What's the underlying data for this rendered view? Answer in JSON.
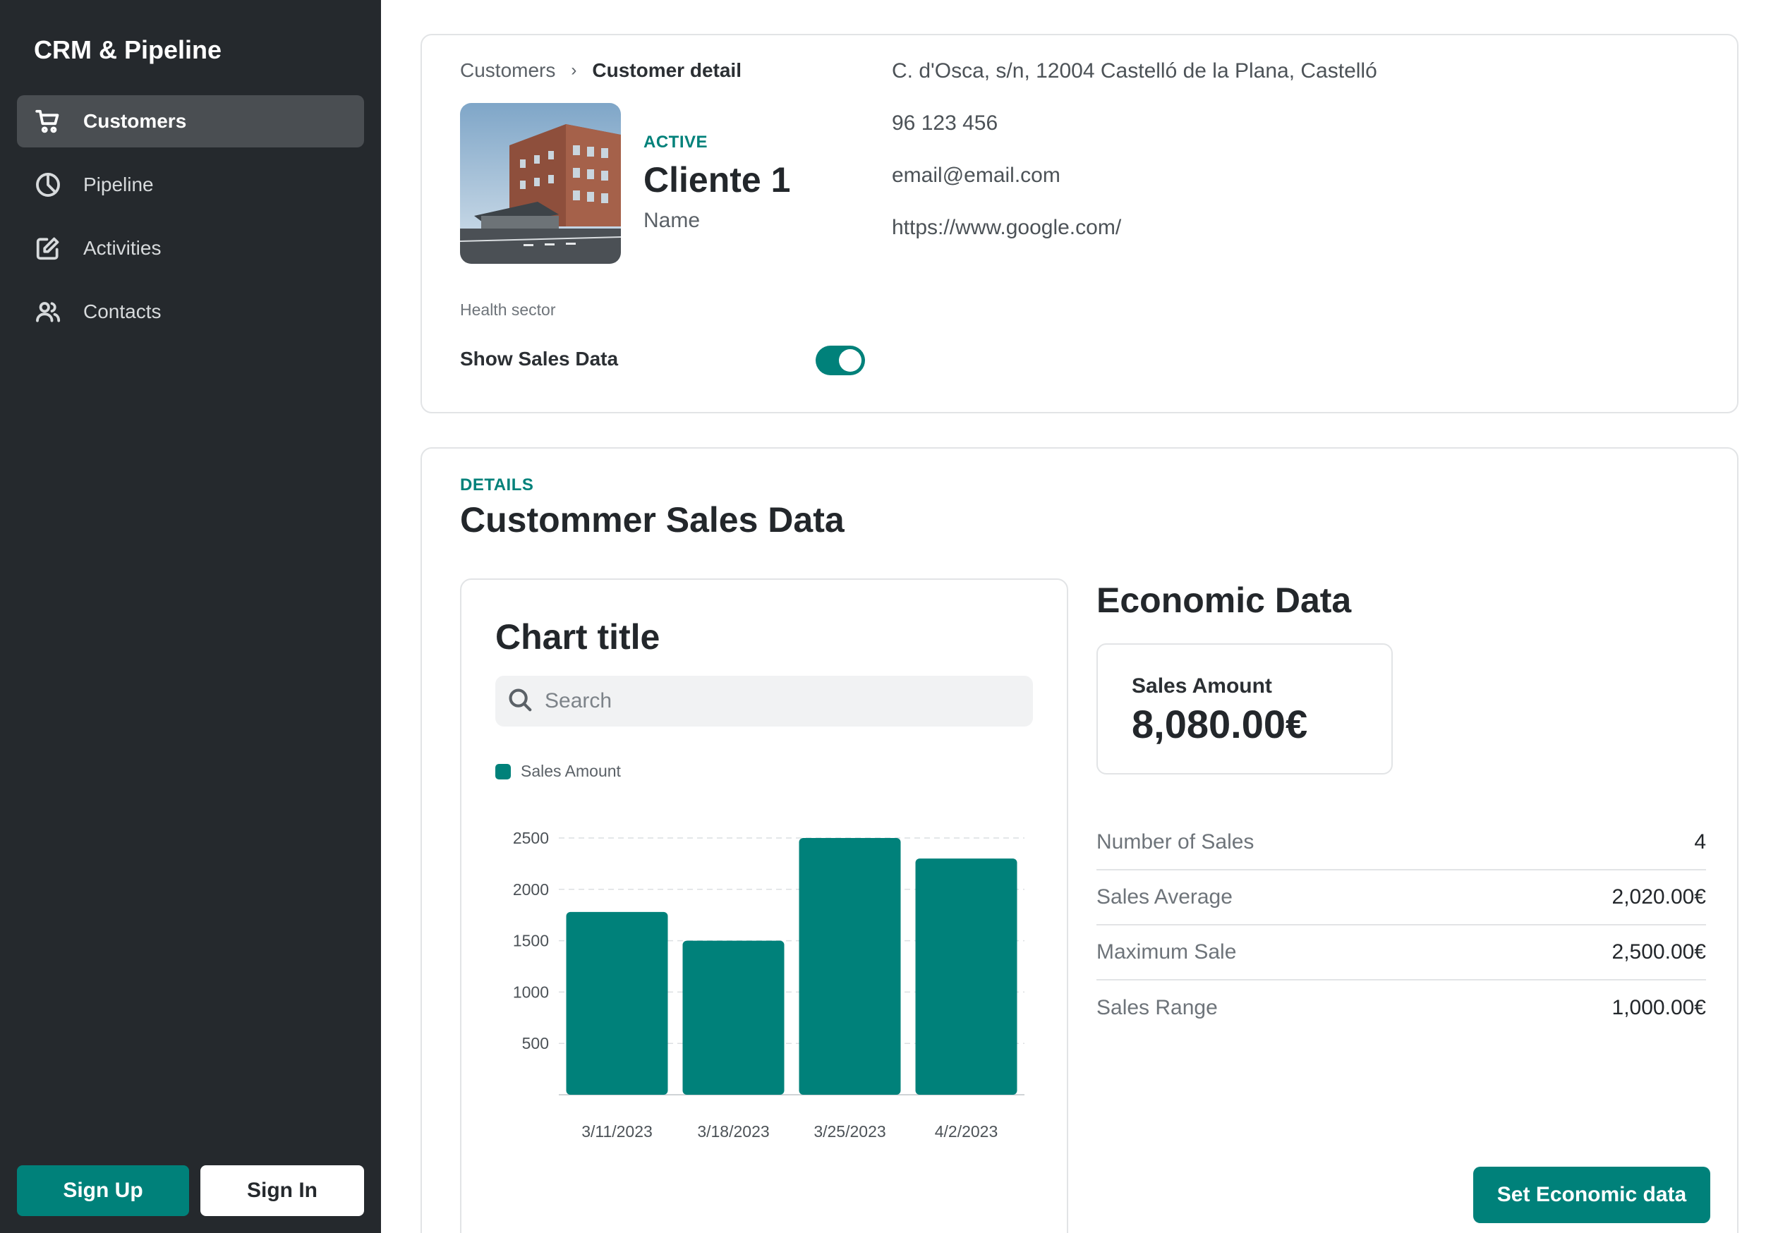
{
  "sidebar": {
    "app_title": "CRM & Pipeline",
    "items": [
      {
        "label": "Customers",
        "icon": "cart-icon",
        "active": true
      },
      {
        "label": "Pipeline",
        "icon": "pie-chart-icon",
        "active": false
      },
      {
        "label": "Activities",
        "icon": "edit-icon",
        "active": false
      },
      {
        "label": "Contacts",
        "icon": "users-icon",
        "active": false
      }
    ],
    "sign_up": "Sign Up",
    "sign_in": "Sign In"
  },
  "customer": {
    "breadcrumb": {
      "parent": "Customers",
      "separator": "›",
      "current": "Customer detail"
    },
    "status": "ACTIVE",
    "name": "Cliente 1",
    "subtitle": "Name",
    "address": "C. d'Osca, s/n, 12004 Castelló de la Plana, Castelló",
    "phone": "96 123 456",
    "email": "email@email.com",
    "website": "https://www.google.com/",
    "sector": "Health sector",
    "show_sales_label": "Show Sales Data",
    "show_sales_on": true
  },
  "sales": {
    "tag": "DETAILS",
    "title": "Custommer Sales Data",
    "chart": {
      "title": "Chart title",
      "search_placeholder": "Search"
    },
    "economic": {
      "title": "Economic Data",
      "amount_label": "Sales Amount",
      "amount_value": "8,080.00€",
      "stats": [
        {
          "label": "Number of Sales",
          "value": "4"
        },
        {
          "label": "Sales Average",
          "value": "2,020.00€"
        },
        {
          "label": "Maximum Sale",
          "value": "2,500.00€"
        },
        {
          "label": "Sales Range",
          "value": "1,000.00€"
        }
      ],
      "button": "Set Economic data"
    }
  },
  "colors": {
    "accent": "#00817a",
    "sidebar_bg": "#25292d",
    "sidebar_active": "#4a4e52"
  },
  "chart_data": {
    "type": "bar",
    "title": "Chart title",
    "categories": [
      "3/11/2023",
      "3/18/2023",
      "3/25/2023",
      "4/2/2023"
    ],
    "series": [
      {
        "name": "Sales Amount",
        "values": [
          1780,
          1500,
          2500,
          2300
        ]
      }
    ],
    "yticks": [
      500,
      1000,
      1500,
      2000,
      2500
    ],
    "ylim": [
      0,
      2500
    ],
    "grid": true,
    "legend": "top-left",
    "color": "#00817a"
  }
}
